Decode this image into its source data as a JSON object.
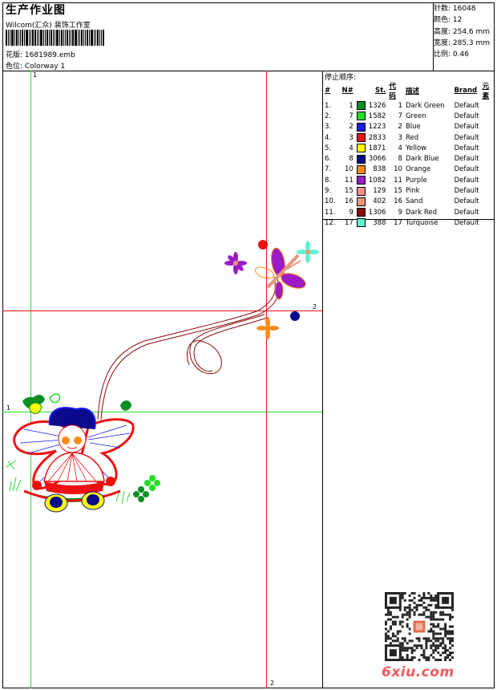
{
  "header": {
    "title": "生产作业图",
    "software": "Wilcom(汇众) 装饰工作室",
    "design_file": "花版: 1681989.emb",
    "colorway": "色位: Colorway 1"
  },
  "stats": {
    "stitches": "针数: 16048",
    "colors": "颜色: 12",
    "height": "高度: 254.6 mm",
    "width": "宽度: 285.3 mm",
    "scale": "比例: 0.46"
  },
  "stop_sequence": {
    "title": "停止顺序:",
    "headers": [
      "#",
      "N#",
      "St.",
      "代码",
      "描述",
      "Brand",
      "元素"
    ],
    "rows": [
      {
        "idx": "1.",
        "n": "1",
        "color": "#0a8f22",
        "st": "1326",
        "code": "1",
        "desc": "Dark Green",
        "brand": "Default"
      },
      {
        "idx": "2.",
        "n": "7",
        "color": "#22dd22",
        "st": "1582",
        "code": "7",
        "desc": "Green",
        "brand": "Default"
      },
      {
        "idx": "3.",
        "n": "2",
        "color": "#1a1aff",
        "st": "1223",
        "code": "2",
        "desc": "Blue",
        "brand": "Default"
      },
      {
        "idx": "4.",
        "n": "3",
        "color": "#ee1111",
        "st": "2833",
        "code": "3",
        "desc": "Red",
        "brand": "Default"
      },
      {
        "idx": "5.",
        "n": "4",
        "color": "#ffff00",
        "st": "1871",
        "code": "4",
        "desc": "Yellow",
        "brand": "Default"
      },
      {
        "idx": "6.",
        "n": "8",
        "color": "#0a0a8c",
        "st": "3066",
        "code": "8",
        "desc": "Dark Blue",
        "brand": "Default"
      },
      {
        "idx": "7.",
        "n": "10",
        "color": "#ff8c1a",
        "st": "838",
        "code": "10",
        "desc": "Orange",
        "brand": "Default"
      },
      {
        "idx": "8.",
        "n": "11",
        "color": "#9c1ac8",
        "st": "1082",
        "code": "11",
        "desc": "Purple",
        "brand": "Default"
      },
      {
        "idx": "9.",
        "n": "15",
        "color": "#ff8f8f",
        "st": "129",
        "code": "15",
        "desc": "Pink",
        "brand": "Default"
      },
      {
        "idx": "10.",
        "n": "16",
        "color": "#e8977a",
        "st": "402",
        "code": "16",
        "desc": "Sand",
        "brand": "Default"
      },
      {
        "idx": "11.",
        "n": "9",
        "color": "#8c0a0a",
        "st": "1306",
        "code": "9",
        "desc": "Dark Red",
        "brand": "Default"
      },
      {
        "idx": "12.",
        "n": "17",
        "color": "#5ff2d0",
        "st": "388",
        "code": "17",
        "desc": "Turquoise",
        "brand": "Default"
      }
    ]
  },
  "guides": {
    "marker_1": "1",
    "marker_2": "2"
  },
  "watermark": "6xiu.com"
}
